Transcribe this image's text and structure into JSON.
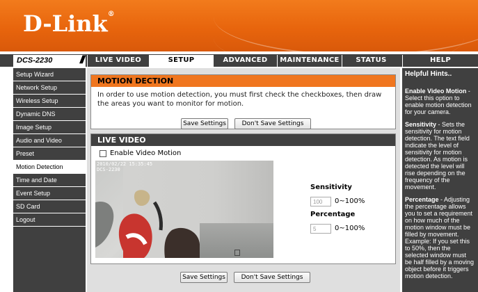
{
  "brand": {
    "logo_text": "D-Link",
    "logo_mark": "®"
  },
  "colors": {
    "orange": "#f0761f",
    "dark": "#404040"
  },
  "model": {
    "name": "DCS-2230",
    "slashes": "///"
  },
  "nav": {
    "tabs": [
      "LIVE VIDEO",
      "SETUP",
      "ADVANCED",
      "MAINTENANCE",
      "STATUS",
      "HELP"
    ],
    "active": "SETUP"
  },
  "sidebar": {
    "items": [
      "Setup Wizard",
      "Network Setup",
      "Wireless Setup",
      "Dynamic DNS",
      "Image Setup",
      "Audio and Video",
      "Preset",
      "Motion Detection",
      "Time and Date",
      "Event Setup",
      "SD Card",
      "Logout"
    ],
    "active": "Motion Detection"
  },
  "motion": {
    "title": "MOTION DECTION",
    "description": "In order to use motion detection, you must first check the checkboxes, then draw the areas you want to monitor for motion.",
    "save_label": "Save Settings",
    "dont_save_label": "Don't Save Settings"
  },
  "live": {
    "title": "LIVE VIDEO",
    "enable_label": "Enable Video Motion",
    "enable_checked": false,
    "timestamp_line1": "2010/02/22 15:35:45",
    "timestamp_line2": "DCS-2230",
    "sensitivity_label": "Sensitivity",
    "sensitivity_value": "100",
    "sensitivity_range": "0~100%",
    "percentage_label": "Percentage",
    "percentage_value": "5",
    "percentage_range": "0~100%"
  },
  "bottom": {
    "save_label": "Save Settings",
    "dont_save_label": "Don't Save Settings"
  },
  "help": {
    "title": "Helpful Hints..",
    "enable_term": "Enable Video Motion",
    "enable_text": " - Select this option to enable motion detection for your camera.",
    "sensitivity_term": "Sensitivity",
    "sensitivity_text": " - Sets the sensitivity for motion detection. The text field indicate the level of sensitivity for motion detection. As motion is detected the level will rise depending on the frequency of the movement.",
    "percentage_term": "Percentage",
    "percentage_text": " - Adjusting the percentage allows you to set a requirement on how much of the motion window must be filled by movement. Example: If you set this to 50%, then the selected window must be half filled by a moving object before it triggers motion detection."
  }
}
